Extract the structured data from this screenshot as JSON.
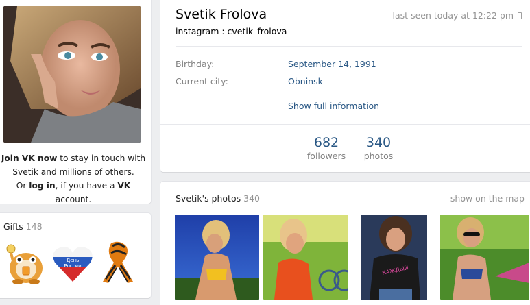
{
  "profile": {
    "name": "Svetik Frolova",
    "status": "instagram : cvetik_frolova",
    "last_seen": "last seen today at 12:22 pm",
    "info": [
      {
        "label": "Birthday:",
        "value": "September 14, 1991"
      },
      {
        "label": "Current city:",
        "value": "Obninsk"
      }
    ],
    "show_full": "Show full information",
    "counters": [
      {
        "num": "682",
        "label": "followers"
      },
      {
        "num": "340",
        "label": "photos"
      }
    ]
  },
  "join": {
    "join_link": "Join VK now",
    "line1_rest": " to stay in touch with",
    "line2": "Svetik and millions of others.",
    "or": "Or ",
    "login": "log in",
    "mid": ", if you have a ",
    "vk": "VK",
    "end": " account."
  },
  "gifts": {
    "title": "Gifts",
    "count": "148"
  },
  "photos": {
    "title": "Svetik's photos",
    "count": "340",
    "show_map": "show on the map"
  },
  "icons": [
    "phone-icon",
    "hamster-gift-icon",
    "russia-day-heart-icon",
    "st-george-ribbon-icon"
  ],
  "colors": {
    "link": "#2a5885",
    "muted": "#828282",
    "background": "#edeef0"
  }
}
